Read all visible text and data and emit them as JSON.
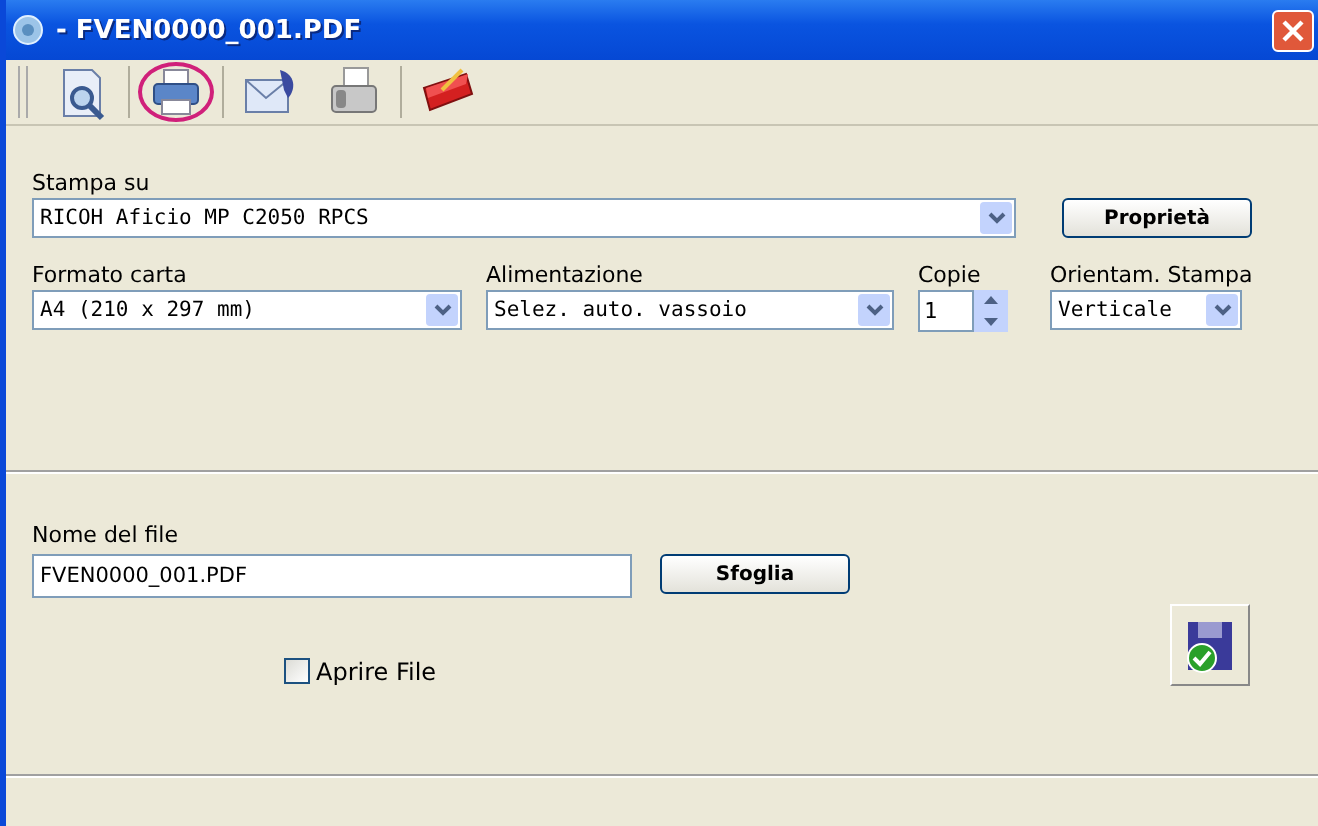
{
  "window": {
    "title": "- FVEN0000_001.PDF"
  },
  "toolbar": [
    {
      "kind": "preview",
      "selected": false
    },
    {
      "kind": "print",
      "selected": true
    },
    {
      "kind": "mail",
      "selected": false
    },
    {
      "kind": "fax",
      "selected": false
    },
    {
      "kind": "toolbox",
      "selected": false
    }
  ],
  "printer": {
    "label": "Stampa su",
    "value": "RICOH Aficio MP C2050 RPCS",
    "button": "Proprietà"
  },
  "paper": {
    "label": "Formato carta",
    "value": "A4 (210 x 297 mm)"
  },
  "feed": {
    "label": "Alimentazione",
    "value": "Selez. auto. vassoio"
  },
  "copies": {
    "label": "Copie",
    "value": "1"
  },
  "orientation": {
    "label": "Orientam. Stampa",
    "value": "Verticale"
  },
  "file": {
    "label": "Nome del file",
    "value": "FVEN0000_001.PDF",
    "button": "Sfoglia"
  },
  "open_file": {
    "label": "Aprire File",
    "checked": false
  }
}
